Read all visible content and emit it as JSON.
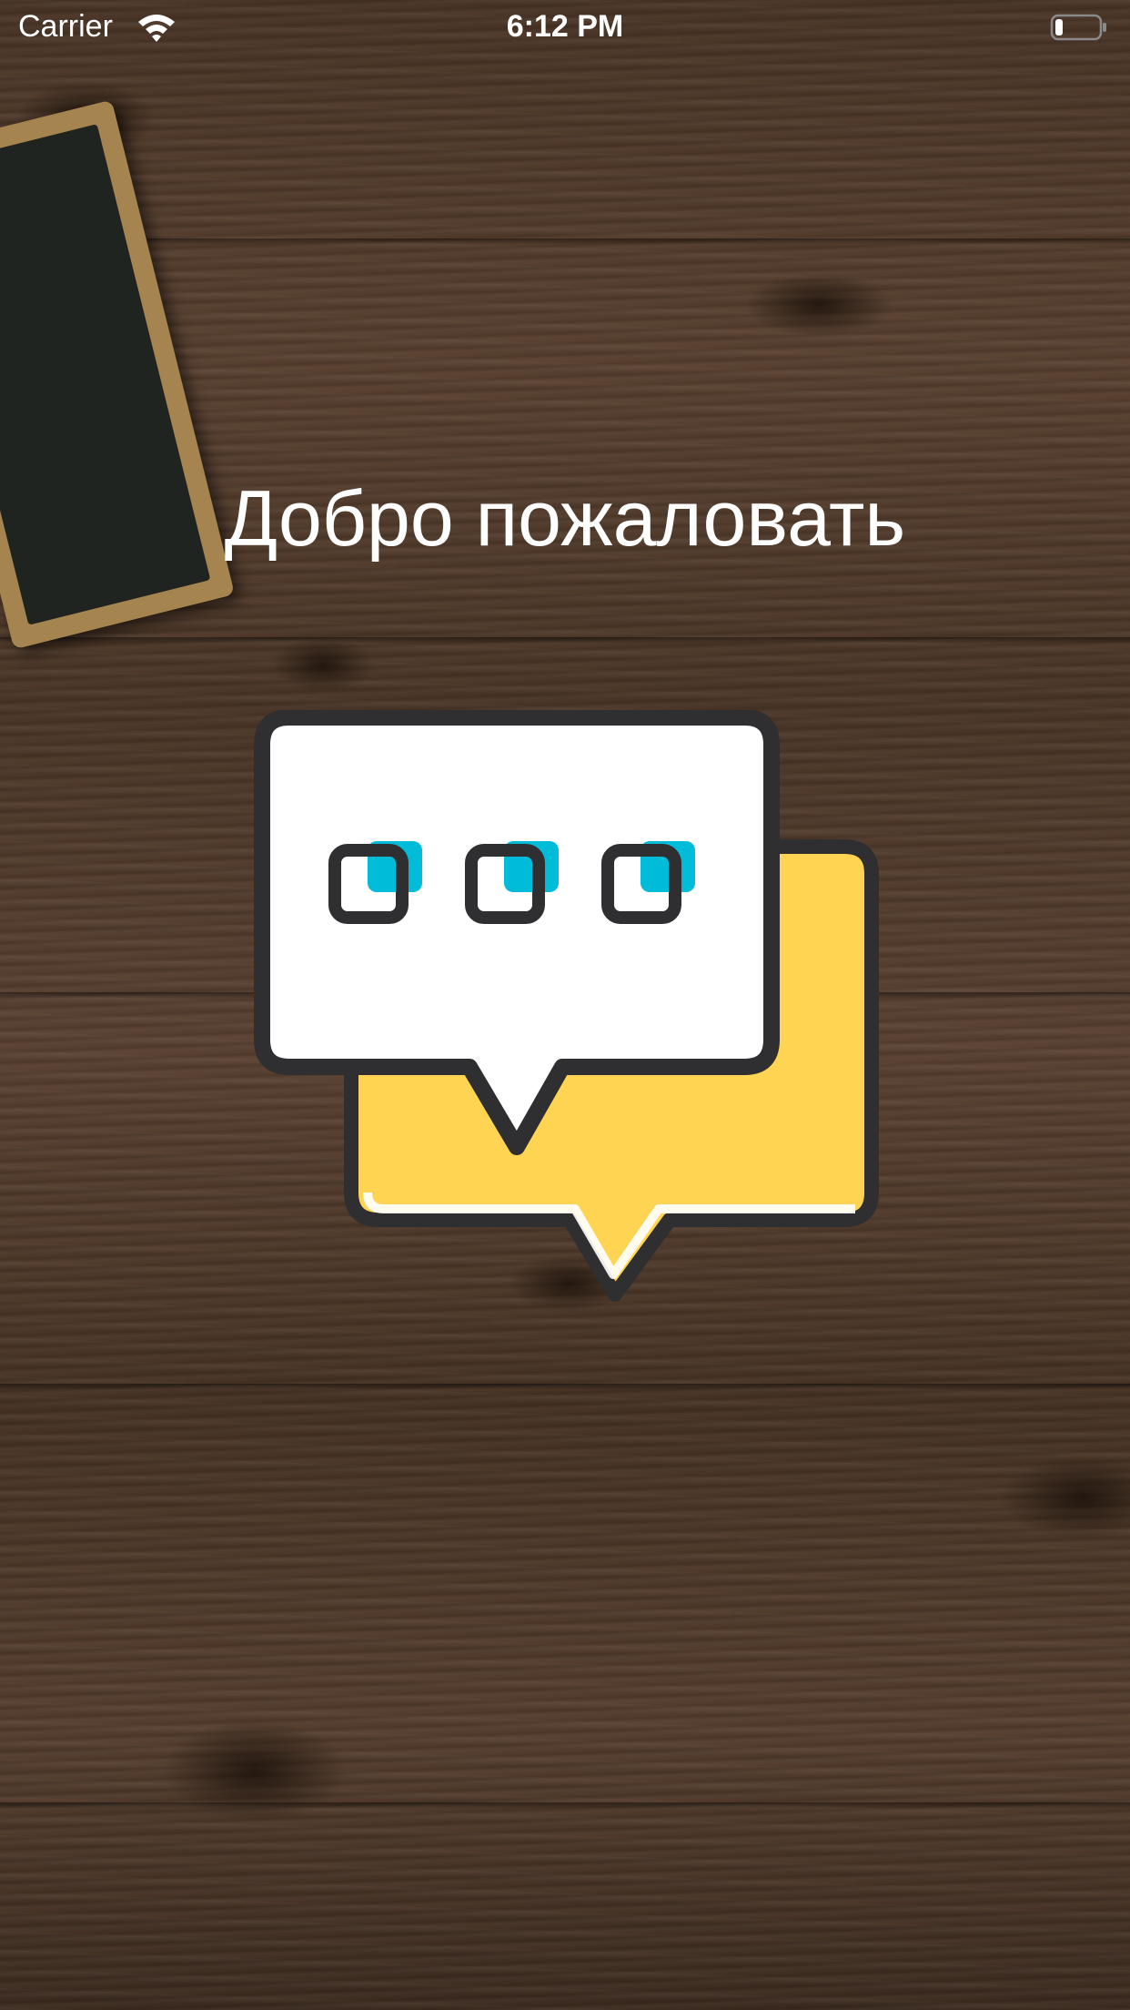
{
  "status_bar": {
    "carrier": "Carrier",
    "time": "6:12 PM",
    "wifi_icon": "wifi-icon",
    "battery_icon": "battery-icon"
  },
  "welcome": {
    "title": "Добро пожаловать"
  },
  "logo": {
    "icon": "chat-bubbles-icon",
    "colors": {
      "outline": "#2f2f31",
      "front_bubble": "#ffffff",
      "back_bubble": "#ffd452",
      "dots": "#00bcd9"
    }
  },
  "background": {
    "texture": "dark wood planks",
    "color": "#4f3a2a"
  }
}
